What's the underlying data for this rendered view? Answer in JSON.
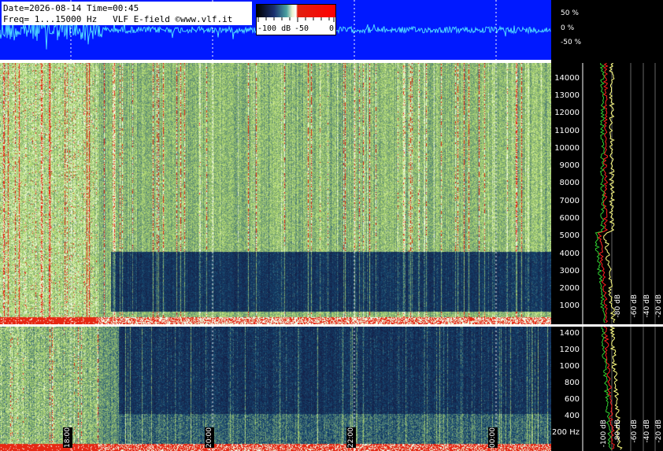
{
  "header": {
    "line1": "Date=2026-08-14 Time=00:45",
    "line2": "Freq= 1...15000 Hz   VLF E-field ©www.vlf.it"
  },
  "color_scale": {
    "labels": [
      "-100 dB",
      "-50",
      "0"
    ],
    "colors": [
      "#000000",
      "#1a2f6e",
      "#4aa0a0",
      "#e8f0d0",
      "#ffffff",
      "#e02010",
      "#ff0000"
    ]
  },
  "waveform": {
    "percent_labels": [
      "50 %",
      "0 %",
      "-50 %"
    ],
    "background": "#0019ff",
    "trace_color": "#4fd8ff"
  },
  "upper_panel": {
    "freq_labels": [
      "14000",
      "13000",
      "12000",
      "11000",
      "10000",
      "9000",
      "8000",
      "7000",
      "6000",
      "5000",
      "4000",
      "3000",
      "2000",
      "1000"
    ],
    "db_labels": [
      "-80 dB",
      "-60 dB",
      "-40 dB",
      "-20 dB"
    ]
  },
  "lower_panel": {
    "freq_labels": [
      "1400",
      "1200",
      "1000",
      "800",
      "600",
      "400",
      "200 Hz"
    ],
    "db_labels": [
      "-100 dB",
      "-80 dB",
      "-60 dB",
      "-40 dB",
      "-20 dB"
    ]
  },
  "time_labels": [
    "18:00",
    "20:00",
    "22:00",
    "00:00"
  ],
  "colors": {
    "spectrum_peak": "#ffff80",
    "spectrum_avg": "#ff2020",
    "spectrum_min": "#30d030"
  }
}
